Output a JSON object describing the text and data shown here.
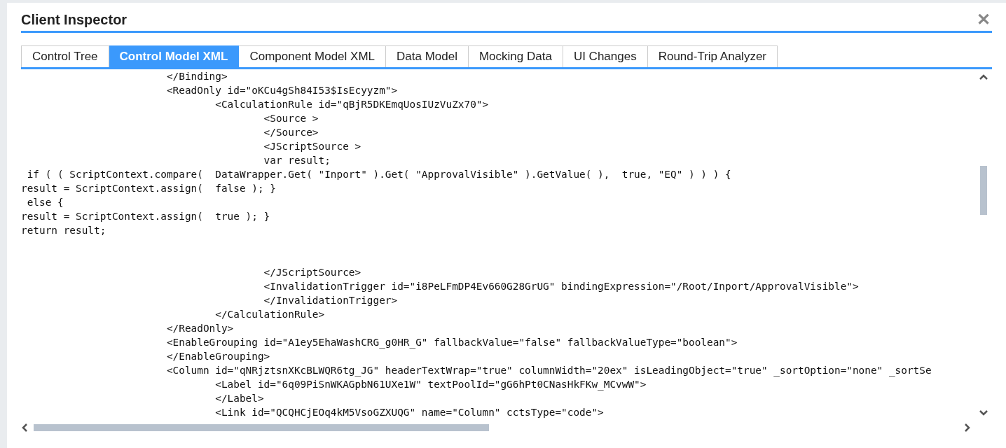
{
  "dialog": {
    "title": "Client Inspector",
    "close": "✕"
  },
  "tabs": [
    {
      "label": "Control Tree",
      "selected": false
    },
    {
      "label": "Control Model XML",
      "selected": true
    },
    {
      "label": "Component Model XML",
      "selected": false
    },
    {
      "label": "Data Model",
      "selected": false
    },
    {
      "label": "Mocking Data",
      "selected": false
    },
    {
      "label": "UI Changes",
      "selected": false
    },
    {
      "label": "Round-Trip Analyzer",
      "selected": false
    }
  ],
  "code_lines": [
    {
      "kind": "code",
      "text": "\t\t\t</Binding>"
    },
    {
      "kind": "code",
      "text": "\t\t\t<ReadOnly id=\"oKCu4gSh84I53$IsEcyyzm\">"
    },
    {
      "kind": "code",
      "text": "\t\t\t\t<CalculationRule id=\"qBjR5DKEmqUosIUzVuZx70\">"
    },
    {
      "kind": "code",
      "text": "\t\t\t\t\t<Source >"
    },
    {
      "kind": "code",
      "text": "\t\t\t\t\t</Source>"
    },
    {
      "kind": "code",
      "text": "\t\t\t\t\t<JScriptSource >"
    },
    {
      "kind": "code",
      "text": "\t\t\t\t\tvar result;"
    },
    {
      "kind": "code",
      "text": " if ( ( ScriptContext.compare(  DataWrapper.Get( \"Inport\" ).Get( \"ApprovalVisible\" ).GetValue( ),  true, \"EQ\" ) ) ) {"
    },
    {
      "kind": "code",
      "text": "result = ScriptContext.assign(  false ); }"
    },
    {
      "kind": "code",
      "text": " else {"
    },
    {
      "kind": "code",
      "text": "result = ScriptContext.assign(  true ); }"
    },
    {
      "kind": "code",
      "text": "return result;"
    },
    {
      "kind": "blank"
    },
    {
      "kind": "blank"
    },
    {
      "kind": "code",
      "text": "\t\t\t\t\t</JScriptSource>"
    },
    {
      "kind": "code",
      "text": "\t\t\t\t\t<InvalidationTrigger id=\"i8PeLFmDP4Ev660G28GrUG\" bindingExpression=\"/Root/Inport/ApprovalVisible\">"
    },
    {
      "kind": "code",
      "text": "\t\t\t\t\t</InvalidationTrigger>"
    },
    {
      "kind": "code",
      "text": "\t\t\t\t</CalculationRule>"
    },
    {
      "kind": "code",
      "text": "\t\t\t</ReadOnly>"
    },
    {
      "kind": "code",
      "text": "\t\t\t<EnableGrouping id=\"A1ey5EhaWashCRG_g0HR_G\" fallbackValue=\"false\" fallbackValueType=\"boolean\">"
    },
    {
      "kind": "code",
      "text": "\t\t\t</EnableGrouping>"
    },
    {
      "kind": "code",
      "text": "\t\t\t<Column id=\"qNRjztsnXKcBLWQR6tg_JG\" headerTextWrap=\"true\" columnWidth=\"20ex\" isLeadingObject=\"true\" _sortOption=\"none\" _sortSe"
    },
    {
      "kind": "code",
      "text": "\t\t\t\t<Label id=\"6q09PiSnWKAGpbN61UXe1W\" textPoolId=\"gG6hPt0CNasHkFKw_MCvwW\">"
    },
    {
      "kind": "code",
      "text": "\t\t\t\t</Label>"
    },
    {
      "kind": "code",
      "text": "\t\t\t\t<Link id=\"QCQHCjEOq4kM5VsoGZXUQG\" name=\"Column\" cctsType=\"code\">"
    }
  ]
}
